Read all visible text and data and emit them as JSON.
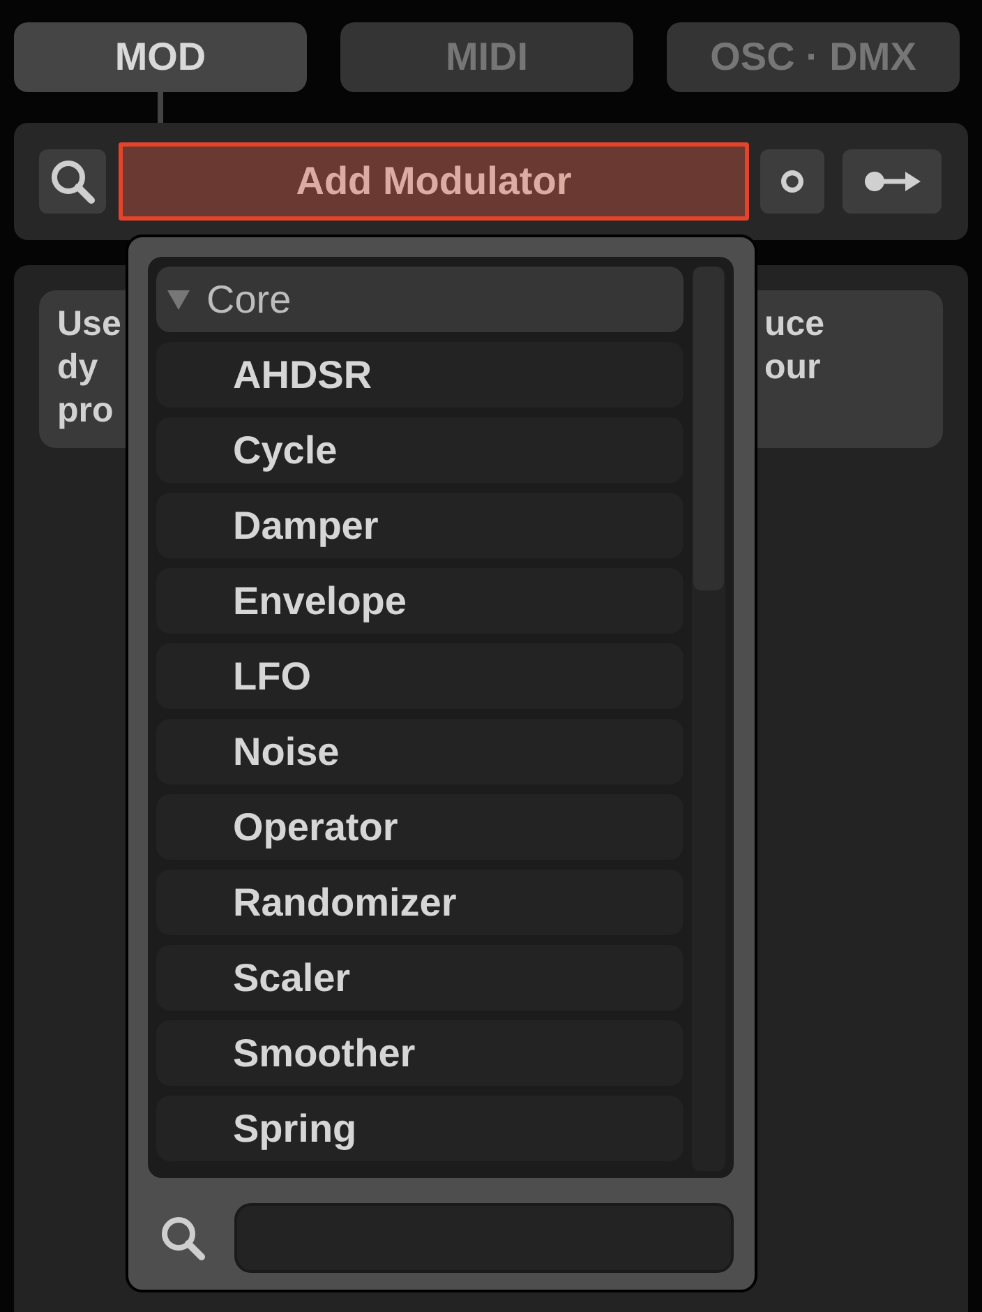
{
  "tabs": [
    {
      "label": "MOD",
      "selected": true
    },
    {
      "label": "MIDI",
      "selected": false
    },
    {
      "label": "OSC · DMX",
      "selected": false
    }
  ],
  "toolbar": {
    "add_button": {
      "label": "Add Modulator",
      "expanded": true
    }
  },
  "info_card": {
    "lines": [
      {
        "left": "Use",
        "right": "uce"
      },
      {
        "left": "dy",
        "right": "our"
      },
      {
        "left": "pro"
      }
    ]
  },
  "modulator_menu": {
    "groups": [
      {
        "label": "Core",
        "expanded": true,
        "children": [
          {
            "label": "AHDSR"
          },
          {
            "label": "Cycle"
          },
          {
            "label": "Damper"
          },
          {
            "label": "Envelope"
          },
          {
            "label": "LFO"
          },
          {
            "label": "Noise"
          },
          {
            "label": "Operator"
          },
          {
            "label": "Randomizer"
          },
          {
            "label": "Scaler"
          },
          {
            "label": "Smoother"
          },
          {
            "label": "Spring"
          }
        ]
      }
    ]
  }
}
